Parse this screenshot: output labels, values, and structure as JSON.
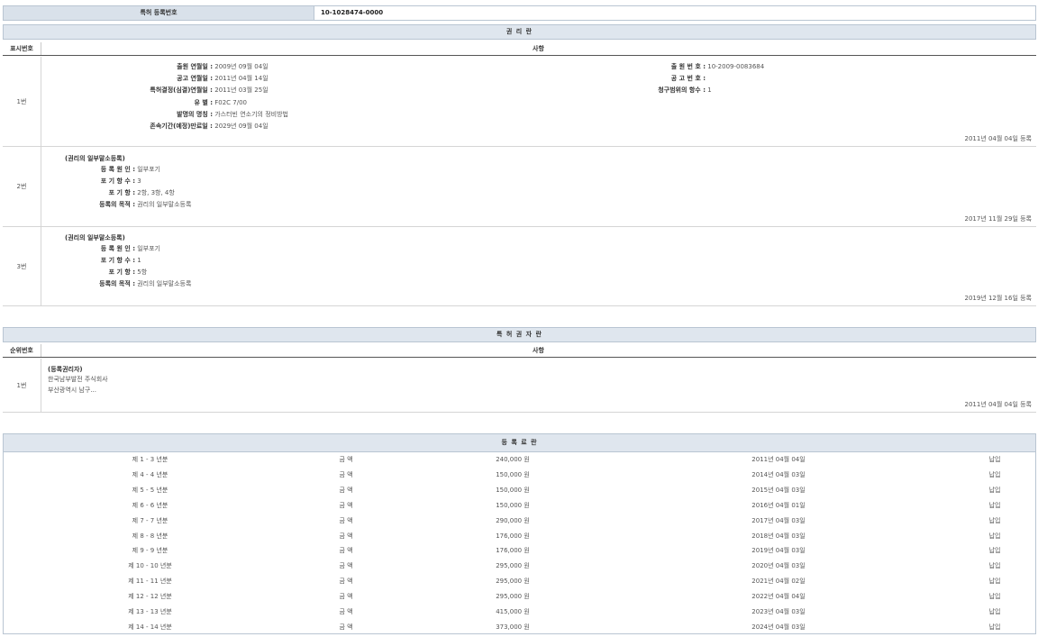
{
  "patent": {
    "label": "특허 등록번호",
    "value": "10-1028474-0000"
  },
  "rights": {
    "title": "권 리 란",
    "col_num": "표시번호",
    "col_desc": "사항",
    "row1": {
      "num": "1번",
      "left_fields": [
        {
          "k": "출원 연월일 :",
          "v": "2009년 09월 04일"
        },
        {
          "k": "공고 연월일 :",
          "v": "2011년 04월 14일"
        },
        {
          "k": "특허결정(심결)연월일 :",
          "v": "2011년 03월 25일"
        },
        {
          "k": "유 별 :",
          "v": "F02C 7/00"
        },
        {
          "k": "발명의 명칭 :",
          "v": "가스터빈 연소기의 정비방법"
        },
        {
          "k": "존속기간(예정)만료일 :",
          "v": "2029년 09월 04일"
        }
      ],
      "right_fields": [
        {
          "k": "출 원 번 호 :",
          "v": "10-2009-0083684"
        },
        {
          "k": "공 고 번 호 :",
          "v": ""
        },
        {
          "k": "청구범위의 항수 :",
          "v": "1"
        }
      ],
      "date": "2011년 04월 04일 등록"
    },
    "row2": {
      "num": "2번",
      "heading": "(권리의 일부말소등록)",
      "fields": [
        {
          "k": "등 록 원 인 :",
          "v": "일부포기"
        },
        {
          "k": "포 기 항 수 :",
          "v": "3"
        },
        {
          "k": "포 기 항 :",
          "v": "2항, 3항, 4항"
        },
        {
          "k": "등록의 목적 :",
          "v": "권리의 일부말소등록"
        }
      ],
      "date": "2017년 11월 29일 등록"
    },
    "row3": {
      "num": "3번",
      "heading": "(권리의 일부말소등록)",
      "fields": [
        {
          "k": "등 록 원 인 :",
          "v": "일부포기"
        },
        {
          "k": "포 기 항 수 :",
          "v": "1"
        },
        {
          "k": "포 기 항 :",
          "v": "5항"
        },
        {
          "k": "등록의 목적 :",
          "v": "권리의 일부말소등록"
        }
      ],
      "date": "2019년 12월 16일 등록"
    }
  },
  "holder": {
    "title": "특 허 권 자 란",
    "col_num": "순위번호",
    "col_desc": "사항",
    "row1": {
      "num": "1번",
      "heading": "(등록권리자)",
      "line1": "한국남부발전 주식회사",
      "line2": "부산광역시 남구...",
      "date": "2011년 04월 04일 등록"
    }
  },
  "fees": {
    "title": "등 록 료 란",
    "rows": [
      {
        "period": "제 1 - 3 년분",
        "label": "금 액",
        "amount": "240,000 원",
        "date": "2011년 04월 04일",
        "status": "납입"
      },
      {
        "period": "제 4 - 4 년분",
        "label": "금 액",
        "amount": "150,000 원",
        "date": "2014년 04월 03일",
        "status": "납입"
      },
      {
        "period": "제 5 - 5 년분",
        "label": "금 액",
        "amount": "150,000 원",
        "date": "2015년 04월 03일",
        "status": "납입"
      },
      {
        "period": "제 6 - 6 년분",
        "label": "금 액",
        "amount": "150,000 원",
        "date": "2016년 04월 01일",
        "status": "납입"
      },
      {
        "period": "제 7 - 7 년분",
        "label": "금 액",
        "amount": "290,000 원",
        "date": "2017년 04월 03일",
        "status": "납입"
      },
      {
        "period": "제 8 - 8 년분",
        "label": "금 액",
        "amount": "176,000 원",
        "date": "2018년 04월 03일",
        "status": "납입"
      },
      {
        "period": "제 9 - 9 년분",
        "label": "금 액",
        "amount": "176,000 원",
        "date": "2019년 04월 03일",
        "status": "납입"
      },
      {
        "period": "제 10 - 10 년분",
        "label": "금 액",
        "amount": "295,000 원",
        "date": "2020년 04월 03일",
        "status": "납입"
      },
      {
        "period": "제 11 - 11 년분",
        "label": "금 액",
        "amount": "295,000 원",
        "date": "2021년 04월 02일",
        "status": "납입"
      },
      {
        "period": "제 12 - 12 년분",
        "label": "금 액",
        "amount": "295,000 원",
        "date": "2022년 04월 04일",
        "status": "납입"
      },
      {
        "period": "제 13 - 13 년분",
        "label": "금 액",
        "amount": "415,000 원",
        "date": "2023년 04월 03일",
        "status": "납입"
      },
      {
        "period": "제 14 - 14 년분",
        "label": "금 액",
        "amount": "373,000 원",
        "date": "2024년 04월 03일",
        "status": "납입"
      }
    ]
  }
}
